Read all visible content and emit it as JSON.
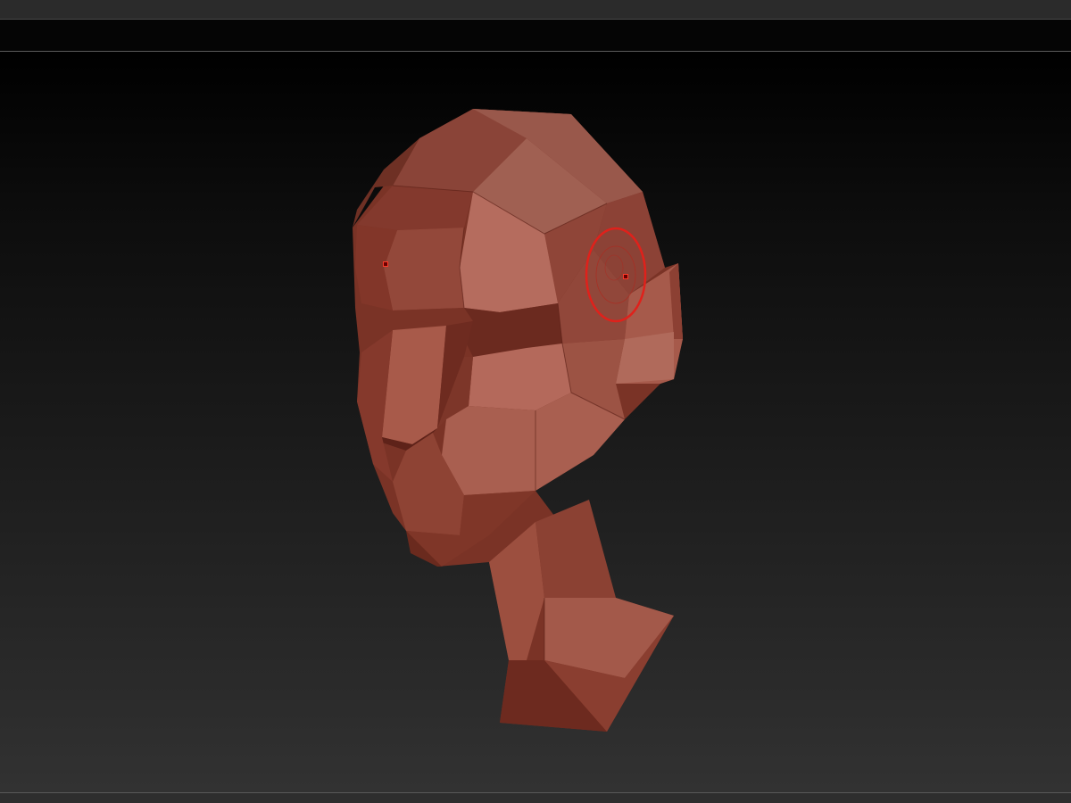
{
  "app": {
    "accent_color": "#c0392b",
    "background_color": "#111111"
  },
  "viewport": {
    "model": {
      "name": "low-poly-head",
      "material_color": "#a8503f"
    },
    "brush_cursor": {
      "shape": "circle",
      "color": "#e0211b"
    }
  }
}
